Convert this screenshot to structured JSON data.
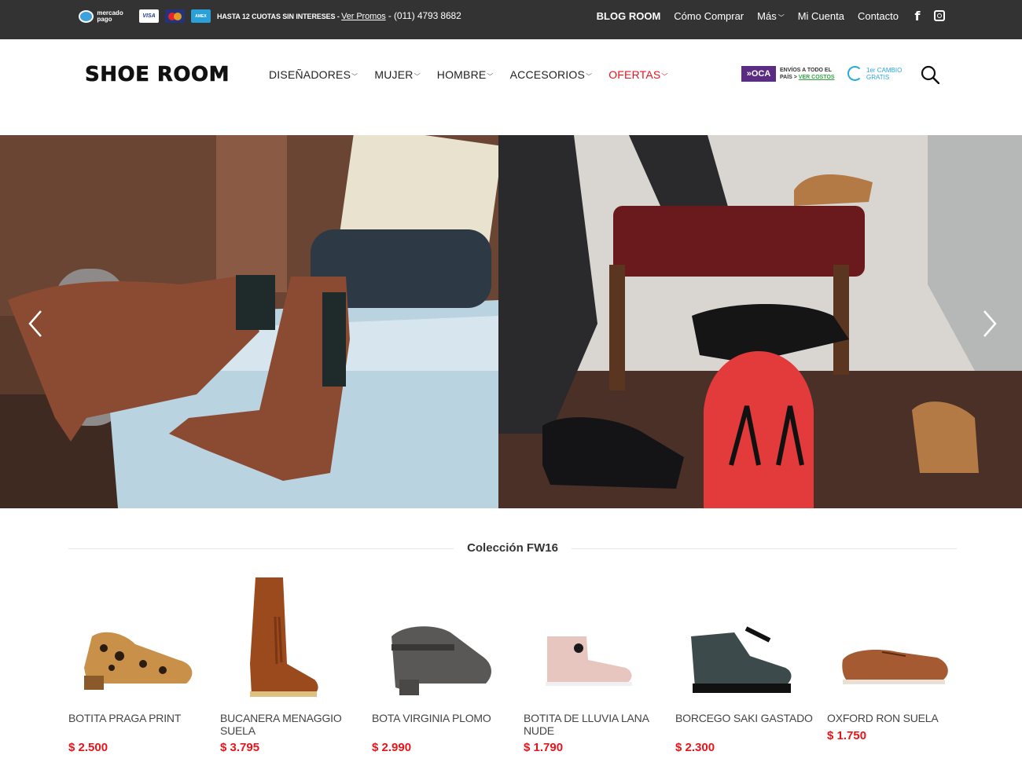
{
  "topbar": {
    "mercadopago": "mercado pago",
    "visa": "VISA",
    "amex": "AMEX",
    "promo_text": "HASTA 12 CUOTAS SIN INTERESES - ",
    "promo_link": "Ver Promos",
    "phone": " - (011) 4793 8682",
    "nav": [
      {
        "label": "BLOG ROOM"
      },
      {
        "label": "Cómo Comprar"
      },
      {
        "label": "Más"
      },
      {
        "label": "Mi Cuenta"
      },
      {
        "label": "Contacto"
      }
    ],
    "more_chevron": "⌄"
  },
  "header": {
    "logo": "SHOE ROOM",
    "nav": [
      {
        "label": "DISEÑADORES"
      },
      {
        "label": "MUJER"
      },
      {
        "label": "HOMBRE"
      },
      {
        "label": "ACCESORIOS"
      },
      {
        "label": "OFERTAS"
      }
    ],
    "oca_logo": "OCA",
    "oca_line1": "ENVÍOS A TODO EL",
    "oca_line2": "PAÍS > ",
    "oca_link": "VER COSTOS",
    "cambio_line1": "1er CAMBIO",
    "cambio_line2": "GRATIS"
  },
  "collection": {
    "title": "Colección FW16",
    "products": [
      {
        "name": "BOTITA PRAGA PRINT",
        "price": "$ 2.500"
      },
      {
        "name": "BUCANERA MENAGGIO SUELA",
        "price": "$ 3.795"
      },
      {
        "name": "BOTA VIRGINIA PLOMO",
        "price": "$ 2.990"
      },
      {
        "name": "BOTITA DE LLUVIA LANA NUDE",
        "price": "$ 1.790"
      },
      {
        "name": "BORCEGO SAKI GASTADO",
        "price": "$ 2.300"
      },
      {
        "name": "OXFORD RON SUELA",
        "price": "$ 1.750"
      }
    ]
  },
  "colors": {
    "topbar_bg": "#333333",
    "sale_red": "#e8141b",
    "oca_purple": "#5b2c83",
    "cambio_blue": "#29a8e0"
  },
  "icons": [
    "facebook-icon",
    "instagram-icon",
    "search-icon",
    "chevron-left-icon",
    "chevron-right-icon"
  ]
}
